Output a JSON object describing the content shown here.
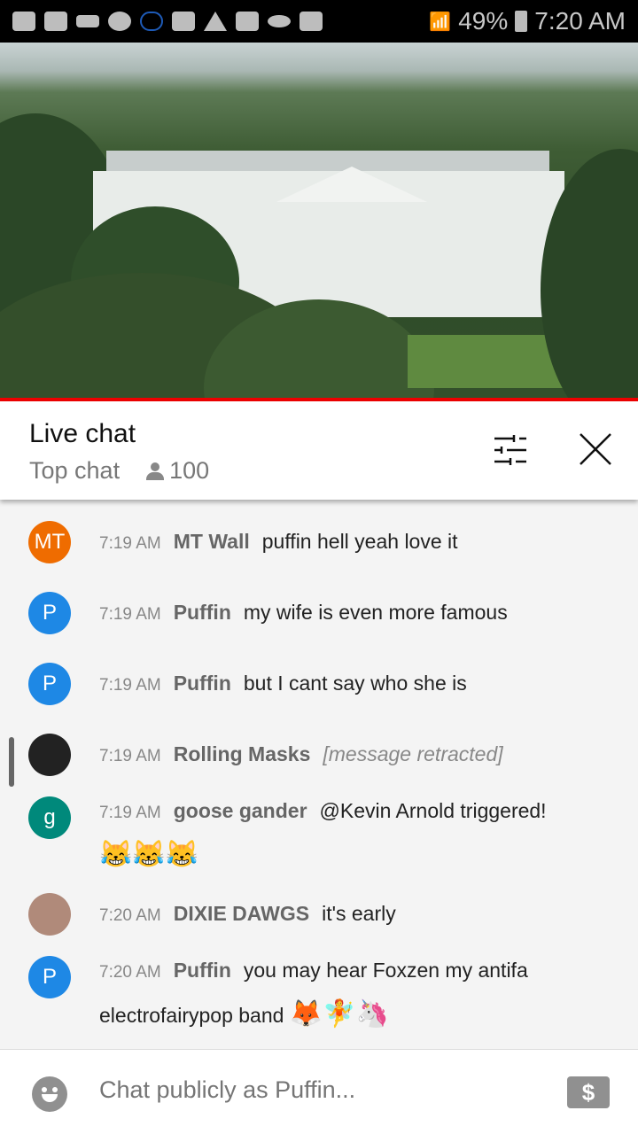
{
  "status_bar": {
    "battery": "49%",
    "time": "7:20 AM",
    "icons": [
      "youtube-icon",
      "youtube-icon",
      "crown-icon",
      "m-app-icon",
      "cloud-outline-icon",
      "folder-icon",
      "warning-icon",
      "image-icon",
      "cloud-icon",
      "bag-icon"
    ]
  },
  "video": {
    "description_icon": "video-player"
  },
  "header": {
    "title": "Live chat",
    "mode": "Top chat",
    "viewers": "100"
  },
  "messages": [
    {
      "time": "7:19 AM",
      "author": "MT Wall",
      "text": "puffin hell yeah love it",
      "avatar": "MT",
      "color": "#ef6c00"
    },
    {
      "time": "7:19 AM",
      "author": "Puffin",
      "text": "my wife is even more famous",
      "avatar": "P",
      "color": "#1e88e5"
    },
    {
      "time": "7:19 AM",
      "author": "Puffin",
      "text": "but I cant say who she is",
      "avatar": "P",
      "color": "#1e88e5"
    },
    {
      "time": "7:19 AM",
      "author": "Rolling Masks",
      "text": "[message retracted]",
      "avatar": "",
      "color": "#222222"
    },
    {
      "time": "7:19 AM",
      "author": "goose gander",
      "text": "@Kevin Arnold triggered!",
      "emoji": "😹😹😹",
      "avatar": "g",
      "color": "#00897b"
    },
    {
      "time": "7:20 AM",
      "author": "DIXIE DAWGS",
      "text": "it's early",
      "avatar": "",
      "color": "#b08a7a"
    },
    {
      "time": "7:20 AM",
      "author": "Puffin",
      "text": "you may hear Foxzen my antifa electrofairypop band",
      "emoji": "🦊🧚🦄",
      "avatar": "P",
      "color": "#1e88e5"
    }
  ],
  "footer": {
    "placeholder": "Chat publicly as Puffin...",
    "superchat_symbol": "$"
  }
}
